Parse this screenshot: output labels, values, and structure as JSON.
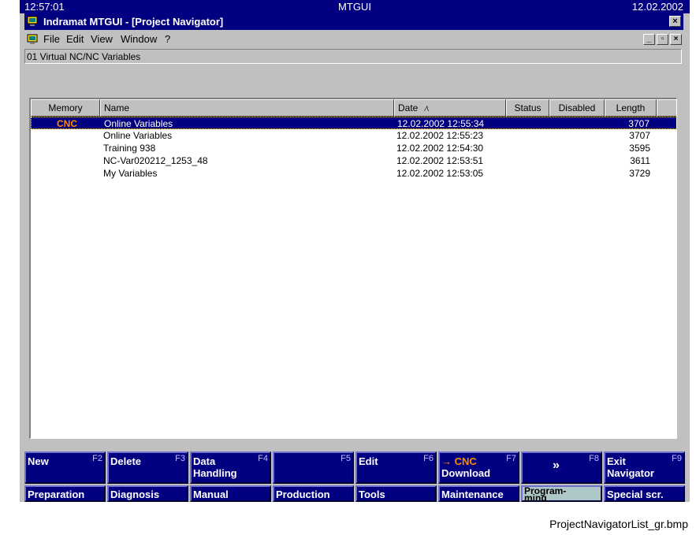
{
  "topbar": {
    "time": "12:57:01",
    "title": "MTGUI",
    "date": "12.02.2002"
  },
  "window": {
    "title": "Indramat MTGUI - [Project Navigator]",
    "close_glyph": "×"
  },
  "menu": {
    "items": [
      "File",
      "Edit",
      "View",
      "Window",
      "?"
    ],
    "mdi_buttons": [
      "_",
      "▫",
      "×"
    ]
  },
  "path": "01 Virtual NC/NC Variables",
  "table": {
    "columns": [
      "Memory",
      "Name",
      "Date",
      "Status",
      "Disabled",
      "Length"
    ],
    "sort_indicator": "⁄\\",
    "rows": [
      {
        "memory": "CNC",
        "name": "Online Variables",
        "date": "12.02.2002 12:55:34",
        "status": "",
        "disabled": "",
        "length": "3707",
        "selected": true
      },
      {
        "memory": "",
        "name": "Online Variables",
        "date": "12.02.2002 12:55:23",
        "status": "",
        "disabled": "",
        "length": "3707"
      },
      {
        "memory": "",
        "name": "Training 938",
        "date": "12.02.2002 12:54:30",
        "status": "",
        "disabled": "",
        "length": "3595"
      },
      {
        "memory": "",
        "name": "NC-Var020212_1253_48",
        "date": "12.02.2002 12:53:51",
        "status": "",
        "disabled": "",
        "length": "3611"
      },
      {
        "memory": "",
        "name": "My Variables",
        "date": "12.02.2002 12:53:05",
        "status": "",
        "disabled": "",
        "length": "3729"
      }
    ]
  },
  "fkeys": [
    {
      "line1": "New",
      "line2": "",
      "num": "F2"
    },
    {
      "line1": "Delete",
      "line2": "",
      "num": "F3"
    },
    {
      "line1": "Data",
      "line2": "Handling",
      "num": "F4"
    },
    {
      "line1": "",
      "line2": "",
      "num": "F5"
    },
    {
      "line1": "Edit",
      "line2": "",
      "num": "F6"
    },
    {
      "line1": "→ CNC",
      "line2": "Download",
      "num": "F7"
    },
    {
      "line1": "»",
      "line2": "",
      "num": "F8"
    },
    {
      "line1": "Exit",
      "line2": "Navigator",
      "num": "F9"
    }
  ],
  "modes": [
    "Preparation",
    "Diagnosis",
    "Manual",
    "Production",
    "Tools",
    "Maintenance",
    "Program-\nming",
    "Special scr."
  ],
  "active_mode_index": 6,
  "caption": "ProjectNavigatorList_gr.bmp",
  "colors": {
    "titlebar": "#000080",
    "accent_orange": "#ff8c00",
    "selection": "#000080",
    "active_mode": "#aec8c8"
  }
}
